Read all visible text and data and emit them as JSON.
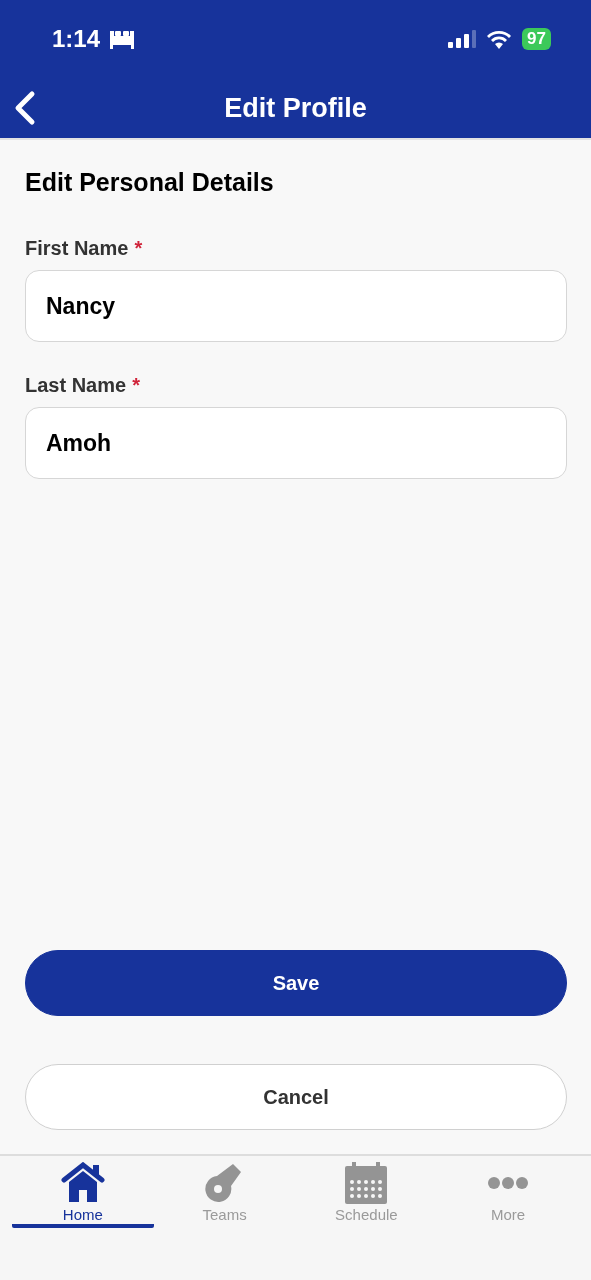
{
  "status_bar": {
    "time": "1:14",
    "battery": "97"
  },
  "nav_bar": {
    "title": "Edit Profile"
  },
  "section_title": "Edit Personal Details",
  "fields": [
    {
      "label": "First Name",
      "required_mark": "*",
      "value": "Nancy"
    },
    {
      "label": "Last Name",
      "required_mark": "*",
      "value": "Amoh"
    }
  ],
  "buttons": [
    {
      "kind": "primary",
      "label": "Save"
    },
    {
      "kind": "secondary",
      "label": "Cancel"
    }
  ],
  "tab_bar": [
    {
      "kind": "home",
      "label": "Home",
      "selected": true
    },
    {
      "kind": "whistle",
      "label": "Teams",
      "selected": false
    },
    {
      "kind": "calendar",
      "label": "Schedule",
      "selected": false
    },
    {
      "kind": "more",
      "label": "More",
      "selected": false
    }
  ]
}
